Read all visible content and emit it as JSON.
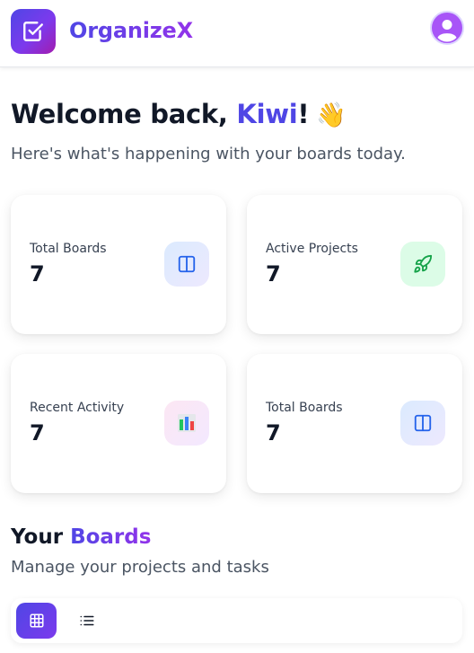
{
  "header": {
    "brand": "OrganizeX",
    "logo_icon": "checkbox-icon",
    "avatar_icon": "user-avatar-icon"
  },
  "welcome": {
    "prefix": "Welcome back, ",
    "name": "Kiwi",
    "suffix": "!",
    "emoji": "👋",
    "subtitle": "Here's what's happening with your boards today."
  },
  "stats": [
    {
      "label": "Total Boards",
      "value": "7",
      "icon": "board-icon"
    },
    {
      "label": "Active Projects",
      "value": "7",
      "icon": "rocket-icon"
    },
    {
      "label": "Recent Activity",
      "value": "7",
      "icon": "bar-chart-icon"
    },
    {
      "label": "Total Boards",
      "value": "7",
      "icon": "board-icon"
    }
  ],
  "boards_section": {
    "title_prefix": "Your ",
    "title_accent": "Boards",
    "subtitle": "Manage your projects and tasks",
    "view_modes": [
      "grid-view-icon",
      "list-view-icon"
    ],
    "active_view": "grid"
  },
  "colors": {
    "brand_primary": "#4f46e5",
    "brand_secondary": "#9333ea",
    "green": "#16a34a"
  }
}
